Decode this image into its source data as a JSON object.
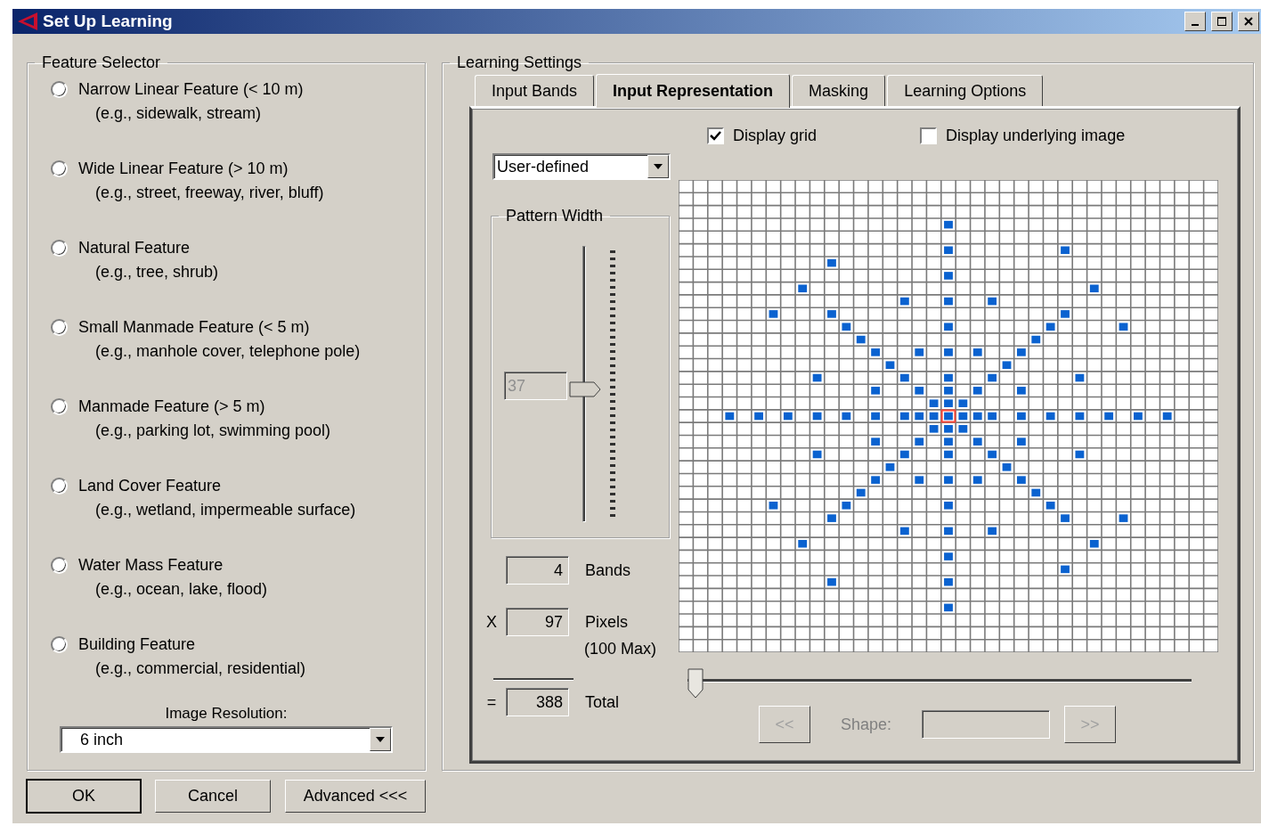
{
  "window": {
    "title": "Set Up Learning"
  },
  "feature_selector": {
    "title": "Feature Selector",
    "options": [
      {
        "label": "Narrow Linear Feature (< 10 m)",
        "example": "(e.g., sidewalk, stream)",
        "selected": false
      },
      {
        "label": "Wide Linear Feature (> 10 m)",
        "example": "(e.g., street, freeway, river, bluff)",
        "selected": false
      },
      {
        "label": "Natural Feature",
        "example": "(e.g., tree, shrub)",
        "selected": false
      },
      {
        "label": "Small Manmade Feature (< 5 m)",
        "example": "(e.g., manhole cover, telephone pole)",
        "selected": false
      },
      {
        "label": "Manmade Feature (> 5 m)",
        "example": "(e.g., parking lot, swimming pool)",
        "selected": false
      },
      {
        "label": "Land Cover Feature",
        "example": "(e.g., wetland, impermeable surface)",
        "selected": false
      },
      {
        "label": "Water Mass Feature",
        "example": "(e.g., ocean, lake, flood)",
        "selected": false
      },
      {
        "label": "Building Feature",
        "example": "(e.g., commercial, residential)",
        "selected": false
      }
    ],
    "resolution": {
      "label": "Image Resolution:",
      "value": "6  inch"
    }
  },
  "buttons": [
    {
      "label": "OK",
      "default": true
    },
    {
      "label": "Cancel",
      "default": false
    },
    {
      "label": "Advanced <<<",
      "default": false
    }
  ],
  "learning_settings": {
    "title": "Learning Settings",
    "tabs": [
      {
        "label": "Input Bands",
        "selected": false
      },
      {
        "label": "Input Representation",
        "selected": true
      },
      {
        "label": "Masking",
        "selected": false
      },
      {
        "label": "Learning Options",
        "selected": false
      }
    ],
    "pattern_type": "User-defined",
    "pattern_width": {
      "title": "Pattern Width",
      "value": "37",
      "disabled": true,
      "level": 0.48
    },
    "display_grid": {
      "label": "Display grid",
      "checked": true
    },
    "display_image": {
      "label": "Display underlying image",
      "checked": false
    },
    "bands": {
      "value": "4",
      "label": "Bands"
    },
    "pixels": {
      "operator": "X",
      "value": "97",
      "label": "Pixels",
      "note": "(100 Max)"
    },
    "total": {
      "operator": "=",
      "value": "388",
      "label": "Total"
    },
    "shape_slider": {
      "level": 0
    },
    "prev_button": "<<",
    "shape_label": "Shape:",
    "next_button": ">>"
  }
}
